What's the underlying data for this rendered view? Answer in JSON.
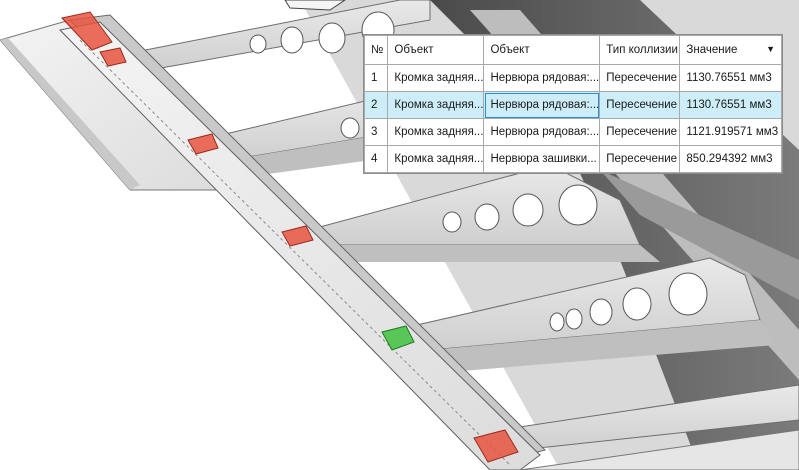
{
  "table": {
    "columns": [
      "№",
      "Объект",
      "Объект",
      "Тип коллизии",
      "Значение"
    ],
    "sort_indicator": "▼",
    "selected_row": 2,
    "rows": [
      {
        "no": "1",
        "obj1": "Кромка задняя...",
        "obj2": "Нервюра рядовая:...",
        "type": "Пересечение",
        "value": "1130.76551 мм3"
      },
      {
        "no": "2",
        "obj1": "Кромка задняя...",
        "obj2": "Нервюра рядовая:...",
        "type": "Пересечение",
        "value": "1130.76551 мм3"
      },
      {
        "no": "3",
        "obj1": "Кромка задняя...",
        "obj2": "Нервюра рядовая:...",
        "type": "Пересечение",
        "value": "1121.919571 мм3"
      },
      {
        "no": "4",
        "obj1": "Кромка задняя...",
        "obj2": "Нервюра зашивки...",
        "type": "Пересечение",
        "value": "850.294392 мм3"
      }
    ]
  },
  "viewport": {
    "collision_markers": [
      {
        "status": "collision",
        "color": "#e8553f"
      },
      {
        "status": "collision",
        "color": "#e8553f"
      },
      {
        "status": "collision",
        "color": "#e8553f"
      },
      {
        "status": "collision",
        "color": "#e8553f"
      },
      {
        "status": "selected",
        "color": "#3fc23f"
      },
      {
        "status": "collision",
        "color": "#e8553f"
      }
    ]
  }
}
